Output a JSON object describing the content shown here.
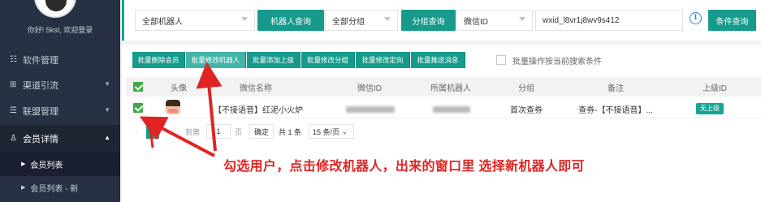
{
  "sidebar": {
    "welcome": "你好! 5kst, 欢迎登录",
    "items": [
      {
        "icon": "☷",
        "label": "软件管理"
      },
      {
        "icon": "⊞",
        "label": "渠道引流"
      },
      {
        "icon": "☰",
        "label": "联盟管理"
      },
      {
        "icon": "♙",
        "label": "会员详情"
      }
    ],
    "subitems": [
      {
        "label": "会员列表"
      },
      {
        "label": "会员列表 - 新"
      }
    ]
  },
  "filters": {
    "robot_select": "全部机器人",
    "robot_query": "机器人查询",
    "group_select": "全部分组",
    "group_query": "分组查询",
    "field_select": "微信ID",
    "search_value": "wxid_l8vr1j8wv9s412",
    "condition_query": "条件查询"
  },
  "toolbar": {
    "buttons": [
      "批量删除会员",
      "批量修改机器人",
      "批量添加上级",
      "批量修改分组",
      "批量修改定向",
      "批量推送消息"
    ],
    "batch_by_search": "批量操作按当前搜索条件"
  },
  "table": {
    "headers": [
      "头像",
      "微信名称",
      "微信ID",
      "所属机器人",
      "分组",
      "备注",
      "上级ID"
    ],
    "rows": [
      {
        "name": "【不接语音】红泥小火炉",
        "group": "首次查券",
        "note": "查券-【不接语音】...",
        "parent": "无上级"
      }
    ]
  },
  "pager": {
    "page": "1",
    "goto_prefix": "到第",
    "goto_value": "1",
    "goto_suffix": "页",
    "confirm": "确定",
    "total": "共 1 条",
    "per_page": "15 条/页"
  },
  "annotation": "勾选用户，点击修改机器人，出来的窗口里 选择新机器人即可",
  "colors": {
    "accent": "#159a8c",
    "sidebar": "#283143",
    "annotation": "#e02424"
  }
}
